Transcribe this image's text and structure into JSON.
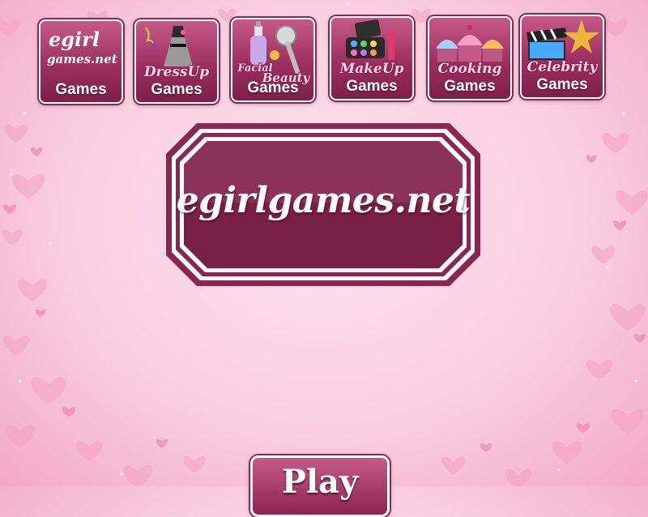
{
  "nav": {
    "tiles": [
      {
        "line1": "egirl",
        "line2": "games.net",
        "caption": "Games"
      },
      {
        "script": "DressUp",
        "caption": "Games"
      },
      {
        "script1": "Facial",
        "script2": "Beauty",
        "caption": "Games"
      },
      {
        "script": "MakeUp",
        "caption": "Games"
      },
      {
        "script": "Cooking",
        "caption": "Games"
      },
      {
        "script": "Celebrity",
        "caption": "Games"
      }
    ]
  },
  "logo": {
    "text": "egirlgames.net"
  },
  "play": {
    "label": "Play"
  },
  "colors": {
    "brand": "#8a2750",
    "background": "#f9cfe0",
    "text": "#ffffff"
  }
}
